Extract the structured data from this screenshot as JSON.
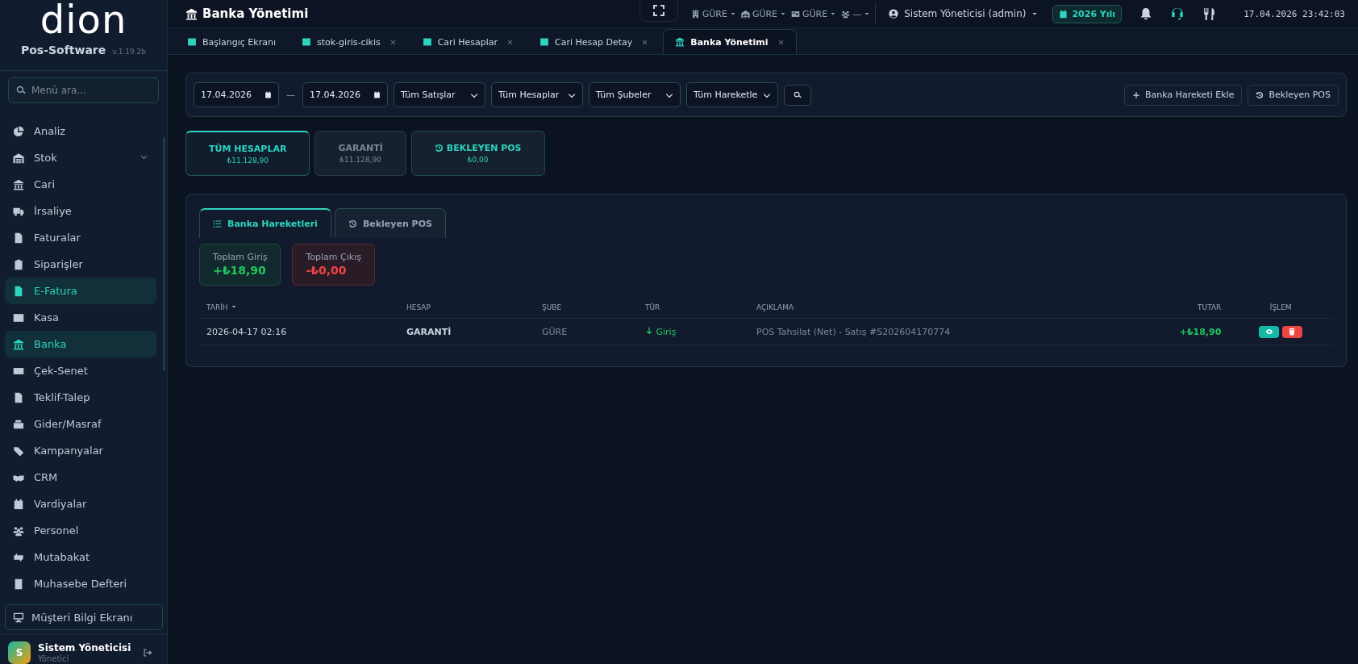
{
  "sidebar": {
    "logo": "dion",
    "app_name": "Pos-Software",
    "version": "v.1.19.2b",
    "search": {
      "placeholder": "Menü ara..."
    },
    "items": [
      {
        "label": "Analiz",
        "kind": "link",
        "selected": false
      },
      {
        "label": "Stok",
        "kind": "group",
        "selected": false
      },
      {
        "label": "Cari",
        "kind": "link",
        "selected": false
      },
      {
        "label": "İrsaliye",
        "kind": "link",
        "selected": false
      },
      {
        "label": "Faturalar",
        "kind": "link",
        "selected": false
      },
      {
        "label": "Siparişler",
        "kind": "link",
        "selected": false
      },
      {
        "label": "E-Fatura",
        "kind": "link",
        "selected": true
      },
      {
        "label": "Kasa",
        "kind": "link",
        "selected": false
      },
      {
        "label": "Banka",
        "kind": "link",
        "selected": true
      },
      {
        "label": "Çek-Senet",
        "kind": "link",
        "selected": false
      },
      {
        "label": "Teklif-Talep",
        "kind": "link",
        "selected": false
      },
      {
        "label": "Gider/Masraf",
        "kind": "link",
        "selected": false
      },
      {
        "label": "Kampanyalar",
        "kind": "link",
        "selected": false
      },
      {
        "label": "CRM",
        "kind": "link",
        "selected": false
      },
      {
        "label": "Vardiyalar",
        "kind": "link",
        "selected": false
      },
      {
        "label": "Personel",
        "kind": "link",
        "selected": false
      },
      {
        "label": "Mutabakat",
        "kind": "link",
        "selected": false
      },
      {
        "label": "Muhasebe Defteri",
        "kind": "link",
        "selected": false
      }
    ],
    "display_button": "Müşteri Bilgi Ekranı",
    "user": {
      "initial": "S",
      "name": "Sistem Yöneticisi",
      "role": "Yönetici"
    }
  },
  "topbar": {
    "title": "Banka Yönetimi",
    "branches": [
      "GÜRE",
      "GÜRE",
      "GÜRE",
      "—"
    ],
    "user": "Sistem Yöneticisi (admin)",
    "year": "2026 Yılı",
    "datetime": "17.04.2026 23:42:03"
  },
  "tabs": [
    {
      "label": "Başlangıç Ekranı",
      "closable": false,
      "selected": false
    },
    {
      "label": "stok-giris-cikis",
      "closable": true,
      "selected": false
    },
    {
      "label": "Cari Hesaplar",
      "closable": true,
      "selected": false
    },
    {
      "label": "Cari Hesap Detay",
      "closable": true,
      "selected": false
    },
    {
      "label": "Banka Yönetimi",
      "closable": true,
      "selected": true
    }
  ],
  "filters": {
    "date_from": "17.04.2026",
    "date_to": "17.04.2026",
    "separator": "—",
    "selects": [
      "Tüm Satışlar",
      "Tüm Hesaplar",
      "Tüm Şubeler",
      "Tüm Hareketle"
    ],
    "buttons": [
      "Banka Hareketi Ekle",
      "Bekleyen POS"
    ]
  },
  "accounts": [
    {
      "name": "TÜM HESAPLAR",
      "amount": "₺11.128,90",
      "kind": "account",
      "selected": true
    },
    {
      "name": "GARANTİ",
      "amount": "₺11.128,90",
      "kind": "account",
      "selected": false
    },
    {
      "name": "BEKLEYEN POS",
      "amount": "₺0,00",
      "kind": "pending",
      "selected": false
    }
  ],
  "view_tabs": [
    {
      "label": "Banka Hareketleri",
      "selected": true
    },
    {
      "label": "Bekleyen POS",
      "selected": false
    }
  ],
  "totals": [
    {
      "label": "Toplam Giriş",
      "value": "+₺18,90",
      "kind": "in"
    },
    {
      "label": "Toplam Çıkış",
      "value": "-₺0,00",
      "kind": "out"
    }
  ],
  "table": {
    "columns": [
      {
        "label": "TARİH",
        "sorted": true
      },
      {
        "label": "HESAP",
        "sorted": false
      },
      {
        "label": "ŞUBE",
        "sorted": false
      },
      {
        "label": "TÜR",
        "sorted": false
      },
      {
        "label": "AÇIKLAMA",
        "sorted": false
      },
      {
        "label": "TUTAR",
        "sorted": false
      },
      {
        "label": "İŞLEM",
        "sorted": false
      }
    ],
    "rows": [
      {
        "date": "2026-04-17 02:16",
        "account": "GARANTİ",
        "branch": "GÜRE",
        "type": "Giriş",
        "kind": "in",
        "description": "POS Tahsilat (Net) - Satış #S202604170774",
        "amount": "+₺18,90"
      }
    ]
  }
}
